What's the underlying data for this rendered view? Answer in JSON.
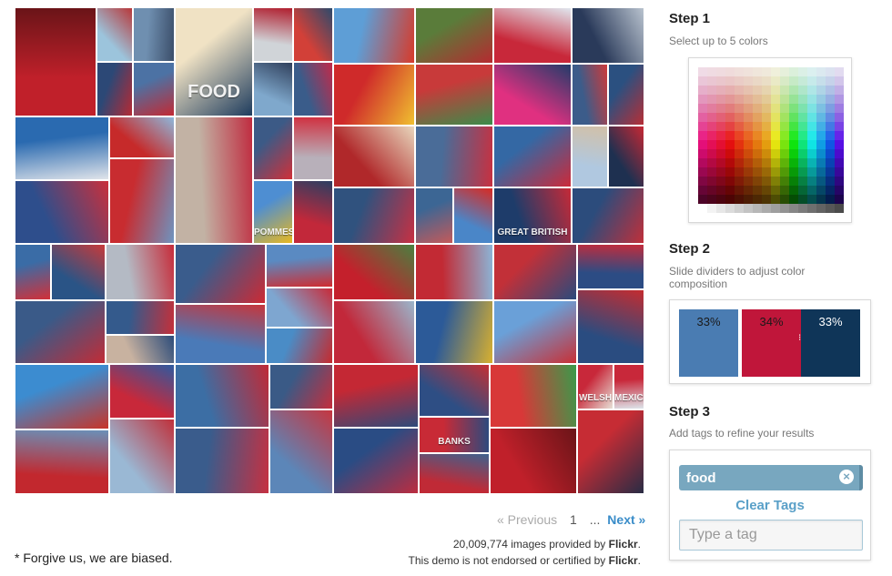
{
  "mosaic": {
    "tiles": [
      {
        "name": "photo-strawberries-market",
        "c1": "#c0202a",
        "c2": "#6a1418"
      },
      {
        "name": "photo-person-blue-hat",
        "c1": "#9cc4dc",
        "c2": "#b8383a"
      },
      {
        "name": "photo-storefront",
        "c1": "#6f8fb0",
        "c2": "#3b4e6a"
      },
      {
        "name": "photo-food-dog-poster",
        "c1": "#f0e2c4",
        "c2": "#1e3c5e",
        "text": "FOOD"
      },
      {
        "name": "photo-woman-sunglasses",
        "c1": "#d0d4d8",
        "c2": "#b01e2e"
      },
      {
        "name": "photo-mural-figure",
        "c1": "#d24038",
        "c2": "#2d4a6c"
      },
      {
        "name": "photo-delivery-truck",
        "c1": "#5e9ed6",
        "c2": "#d83a2a"
      },
      {
        "name": "photo-green-beans",
        "c1": "#5a7c3a",
        "c2": "#b62a30"
      },
      {
        "name": "photo-red-tent-crowd",
        "c1": "#c8283a",
        "c2": "#e0e6ee"
      },
      {
        "name": "photo-politicians",
        "c1": "#2a3a5a",
        "c2": "#b8c2ce"
      },
      {
        "name": "photo-flag-child",
        "c1": "#2c4876",
        "c2": "#b52a34"
      },
      {
        "name": "photo-red-sign-building",
        "c1": "#4c72a4",
        "c2": "#c22a34"
      },
      {
        "name": "photo-street-pole",
        "c1": "#7fa8cc",
        "c2": "#30405c"
      },
      {
        "name": "photo-woman-red-scarf",
        "c1": "#3a5c8a",
        "c2": "#c02a4a"
      },
      {
        "name": "photo-in-n-out-sign",
        "c1": "#cf2a2a",
        "c2": "#f0c030"
      },
      {
        "name": "photo-candy-pile",
        "c1": "#c83a3a",
        "c2": "#3a8c4a"
      },
      {
        "name": "photo-pink-brain-food",
        "c1": "#e03080",
        "c2": "#223c6a"
      },
      {
        "name": "photo-man-portrait",
        "c1": "#3c5c8a",
        "c2": "#cc3a3a"
      },
      {
        "name": "photo-mascot",
        "c1": "#2b5080",
        "c2": "#b62f36"
      },
      {
        "name": "photo-boat-harbor",
        "c1": "#2a6ab0",
        "c2": "#e0e4ea"
      },
      {
        "name": "photo-food-truck",
        "c1": "#c62a2a",
        "c2": "#8eb8dc"
      },
      {
        "name": "photo-family-selfie",
        "c1": "#c2b2a4",
        "c2": "#c02c40"
      },
      {
        "name": "photo-man-glasses",
        "c1": "#3c5a86",
        "c2": "#d03038"
      },
      {
        "name": "photo-baby-smiling",
        "c1": "#b8b0ba",
        "c2": "#d03040"
      },
      {
        "name": "photo-plate-meal",
        "c1": "#b0282a",
        "c2": "#e8d6bc"
      },
      {
        "name": "photo-group-friends",
        "c1": "#4a6c98",
        "c2": "#c83040"
      },
      {
        "name": "photo-blue-soda-bottle",
        "c1": "#3468a4",
        "c2": "#cc2a3a"
      },
      {
        "name": "photo-girl-blonde",
        "c1": "#b0c8e0",
        "c2": "#d2c0a8"
      },
      {
        "name": "photo-mask-costume",
        "c1": "#1e3050",
        "c2": "#c62834"
      },
      {
        "name": "photo-red-semi-truck",
        "c1": "#c82c30",
        "c2": "#6e94c0"
      },
      {
        "name": "photo-fries-statue",
        "c1": "#4e8ed2",
        "c2": "#e8b820",
        "text": "POMMES"
      },
      {
        "name": "photo-neon-sign",
        "c1": "#c2283a",
        "c2": "#2a3e62"
      },
      {
        "name": "photo-blue-plate",
        "c1": "#2e4e8c",
        "c2": "#c9303c"
      },
      {
        "name": "photo-woman-booth",
        "c1": "#30527e",
        "c2": "#c83042"
      },
      {
        "name": "photo-man-closeup",
        "c1": "#3c6694",
        "c2": "#c45a5a"
      },
      {
        "name": "photo-mcdonalds-sign",
        "c1": "#4a86c8",
        "c2": "#d82a22"
      },
      {
        "name": "photo-book-cover",
        "c1": "#1e3c6a",
        "c2": "#c52a38",
        "text": "GREAT BRITISH"
      },
      {
        "name": "photo-person-walking",
        "c1": "#2c4c7c",
        "c2": "#c0303a"
      },
      {
        "name": "photo-strawberry-cake",
        "c1": "#3a6ca6",
        "c2": "#d23038"
      },
      {
        "name": "photo-glass-building",
        "c1": "#2a5486",
        "c2": "#c83a3a"
      },
      {
        "name": "photo-group-standing",
        "c1": "#b4bac4",
        "c2": "#c62c3a"
      },
      {
        "name": "photo-man-red-shirt",
        "c1": "#3a5c8c",
        "c2": "#cc2a34"
      },
      {
        "name": "photo-carnival-stand",
        "c1": "#5a8ac2",
        "c2": "#d02c30"
      },
      {
        "name": "photo-strawberries-bowl",
        "c1": "#c4202c",
        "c2": "#4a8040"
      },
      {
        "name": "photo-red-car",
        "c1": "#c22a34",
        "c2": "#8cb4d6"
      },
      {
        "name": "photo-red-packets",
        "c1": "#c23038",
        "c2": "#2a4a7c"
      },
      {
        "name": "photo-heart-art",
        "c1": "#2c4c84",
        "c2": "#c22c3c"
      },
      {
        "name": "photo-kids-festival",
        "c1": "#7ea6d0",
        "c2": "#c82a38"
      },
      {
        "name": "photo-drinks-pour",
        "c1": "#345a8c",
        "c2": "#c4303a"
      },
      {
        "name": "photo-tent-market",
        "c1": "#3a5a88",
        "c2": "#c22c36"
      },
      {
        "name": "photo-bag-snack",
        "c1": "#4a7ab8",
        "c2": "#c6363c"
      },
      {
        "name": "photo-vintage-car",
        "c1": "#c2283a",
        "c2": "#9ab6cc"
      },
      {
        "name": "photo-blue-packets",
        "c1": "#2c5a98",
        "c2": "#d8b030"
      },
      {
        "name": "photo-flag-sky",
        "c1": "#6aa0d8",
        "c2": "#c83036"
      },
      {
        "name": "photo-red-kite",
        "c1": "#2a4c80",
        "c2": "#c42c30"
      },
      {
        "name": "photo-men-eating",
        "c1": "#c8b2a0",
        "c2": "#2c4c7a"
      },
      {
        "name": "photo-tart",
        "c1": "#4a8cc6",
        "c2": "#c62a2e"
      },
      {
        "name": "photo-cupcakes",
        "c1": "#3c8cd0",
        "c2": "#c83428"
      },
      {
        "name": "photo-berries-cream",
        "c1": "#c8283a",
        "c2": "#2e5aa0"
      },
      {
        "name": "photo-child-court",
        "c1": "#3c6ea4",
        "c2": "#c02a36"
      },
      {
        "name": "photo-woman-red",
        "c1": "#3a5a86",
        "c2": "#c42e3c"
      },
      {
        "name": "photo-sign-red",
        "c1": "#c42834",
        "c2": "#2e4a7a"
      },
      {
        "name": "photo-person-stripe",
        "c1": "#2e4e84",
        "c2": "#c43034"
      },
      {
        "name": "photo-rainbow-candy",
        "c1": "#d83838",
        "c2": "#3a9a4a"
      },
      {
        "name": "photo-welsh-poster",
        "c1": "#c8283a",
        "c2": "#e6e0d6",
        "text": "WELSH"
      },
      {
        "name": "photo-mexican-sign",
        "c1": "#c8283a",
        "c2": "#dde4ea",
        "text": "MEXICAN"
      },
      {
        "name": "photo-faces-mural",
        "c1": "#5c86b8",
        "c2": "#c63640"
      },
      {
        "name": "photo-banks-jersey",
        "c1": "#c82a36",
        "c2": "#2c4a7e",
        "text": "BANKS"
      },
      {
        "name": "photo-bull-mascot",
        "c1": "#c62c34",
        "c2": "#1e2c46"
      },
      {
        "name": "photo-man-red-shirt-2",
        "c1": "#c2282e",
        "c2": "#6a90b8"
      },
      {
        "name": "photo-crowd-street",
        "c1": "#9ab8d4",
        "c2": "#c0303a"
      },
      {
        "name": "photo-man-shades",
        "c1": "#3a5c8c",
        "c2": "#c83040"
      },
      {
        "name": "photo-plate-fruit",
        "c1": "#2a4c84",
        "c2": "#c82a3a"
      },
      {
        "name": "photo-red-hat",
        "c1": "#c02a36",
        "c2": "#3e628e"
      }
    ]
  },
  "pager": {
    "previous": "« Previous",
    "current": "1",
    "ellipsis": "...",
    "next": "Next »"
  },
  "credits": {
    "count": "20,009,774",
    "images_text": " images provided by ",
    "provider": "Flickr",
    "period": ".",
    "disclaimer": "This demo is not endorsed or certified by ",
    "provider2": "Flickr",
    "period2": "."
  },
  "footnote": "* Forgive us, we are biased.",
  "steps": {
    "step1": {
      "title": "Step 1",
      "desc": "Select up to 5 colors"
    },
    "step2": {
      "title": "Step 2",
      "desc": "Slide dividers to adjust color composition"
    },
    "step3": {
      "title": "Step 3",
      "desc": "Add tags to refine your results"
    }
  },
  "composition": {
    "segments": [
      {
        "pct": "33%",
        "color": "#4a7cb2"
      },
      {
        "pct": "34%",
        "color": "#c0163a"
      },
      {
        "pct": "33%",
        "color": "#0f3558"
      }
    ]
  },
  "tags": {
    "items": [
      {
        "label": "food"
      }
    ],
    "clear_label": "Clear Tags",
    "input_placeholder": "Type a tag"
  }
}
